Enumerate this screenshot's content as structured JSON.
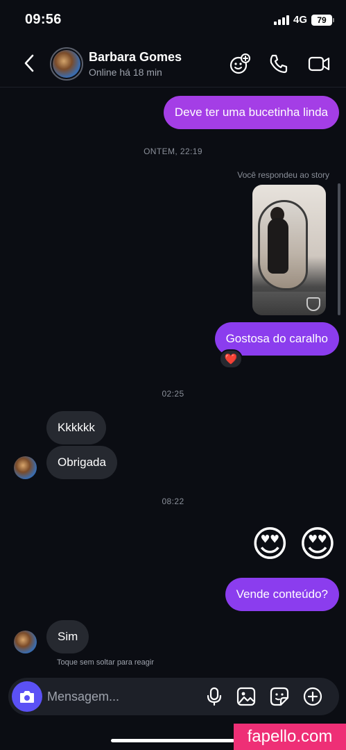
{
  "status_bar": {
    "time": "09:56",
    "network": "4G",
    "battery": "79"
  },
  "header": {
    "contact_name": "Barbara Gomes",
    "contact_status": "Online há 18 min",
    "icons": [
      "back-icon",
      "avatar-effects-icon",
      "phone-icon",
      "video-icon"
    ]
  },
  "messages": {
    "m1": "Deve ter uma bucetinha linda",
    "sep1": "ONTEM, 22:19",
    "story_label": "Você respondeu ao story",
    "m2": "Gostosa do caralho",
    "reaction": "❤️",
    "sep2": "02:25",
    "m3": "Kkkkkk",
    "m4": "Obrigada",
    "sep3": "08:22",
    "emoji": "😍 😍",
    "m5": "Vende conteúdo?",
    "m6": "Sim",
    "hint": "Toque sem soltar para reagir"
  },
  "composer": {
    "placeholder": "Mensagem..."
  },
  "watermark": "fapello.com",
  "colors": {
    "sent": "#8b3dee",
    "received": "#262930",
    "camera": "#5b51f5",
    "background": "#0b0d13"
  }
}
